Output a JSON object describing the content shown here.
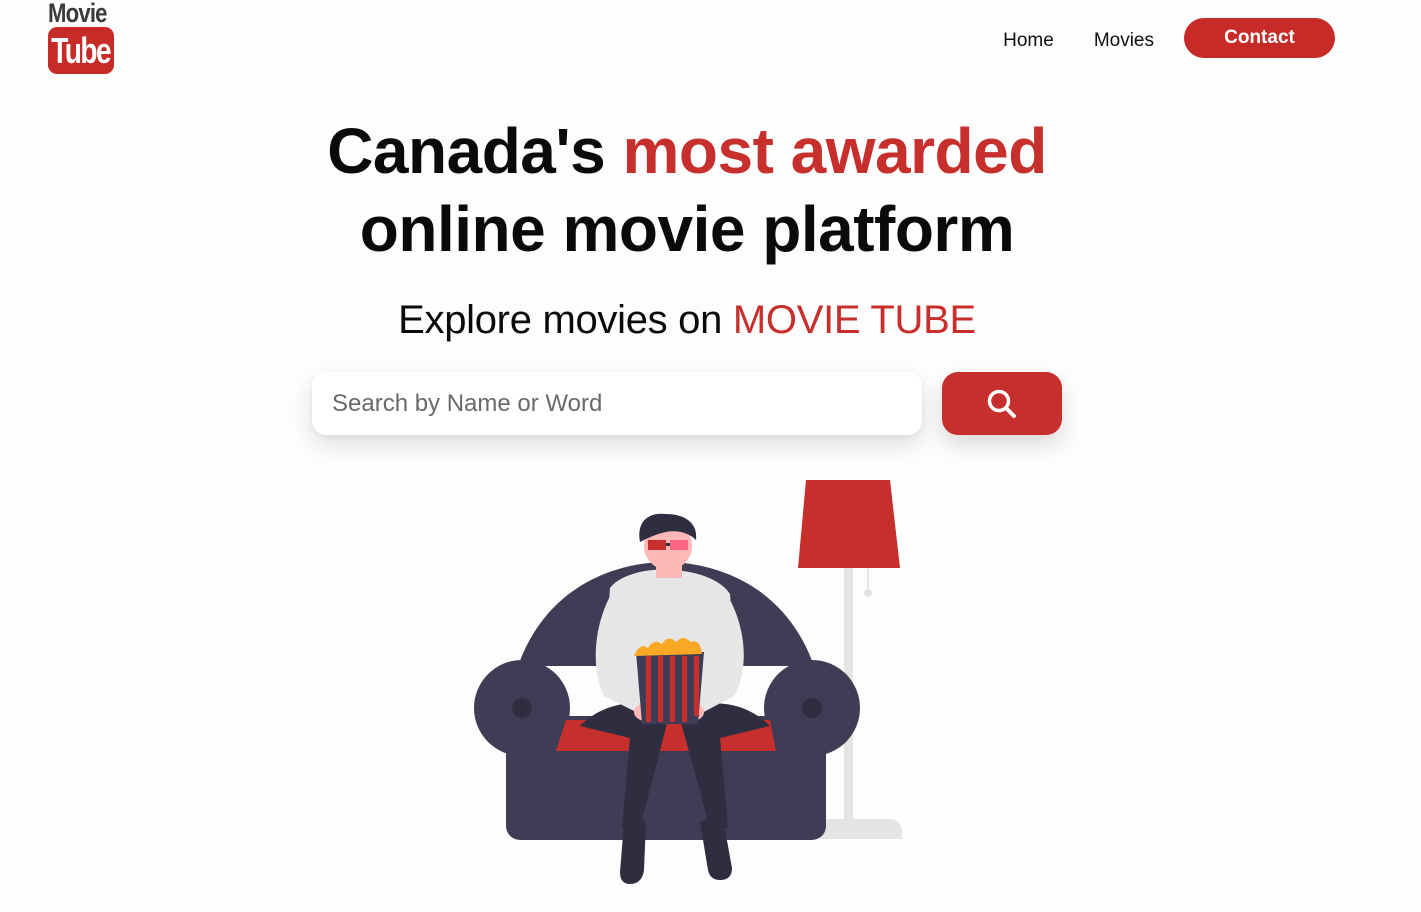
{
  "logo": {
    "top_text": "Movie",
    "box_text": "Tube"
  },
  "nav": {
    "home_label": "Home",
    "movies_label": "Movies",
    "contact_label": "Contact"
  },
  "hero": {
    "headline_part1": "Canada's ",
    "headline_accent": "most awarded",
    "headline_line2": "online movie platform",
    "subhead_part1": "Explore movies on ",
    "subhead_accent": "MOVIE TUBE"
  },
  "search": {
    "placeholder": "Search by Name or Word",
    "value": "",
    "icon": "search-icon"
  },
  "illustration": {
    "name": "person-watching-movie-illustration"
  },
  "colors": {
    "accent": "#c62f2c",
    "sofa": "#3f3d56",
    "background": "#fefdfd"
  }
}
